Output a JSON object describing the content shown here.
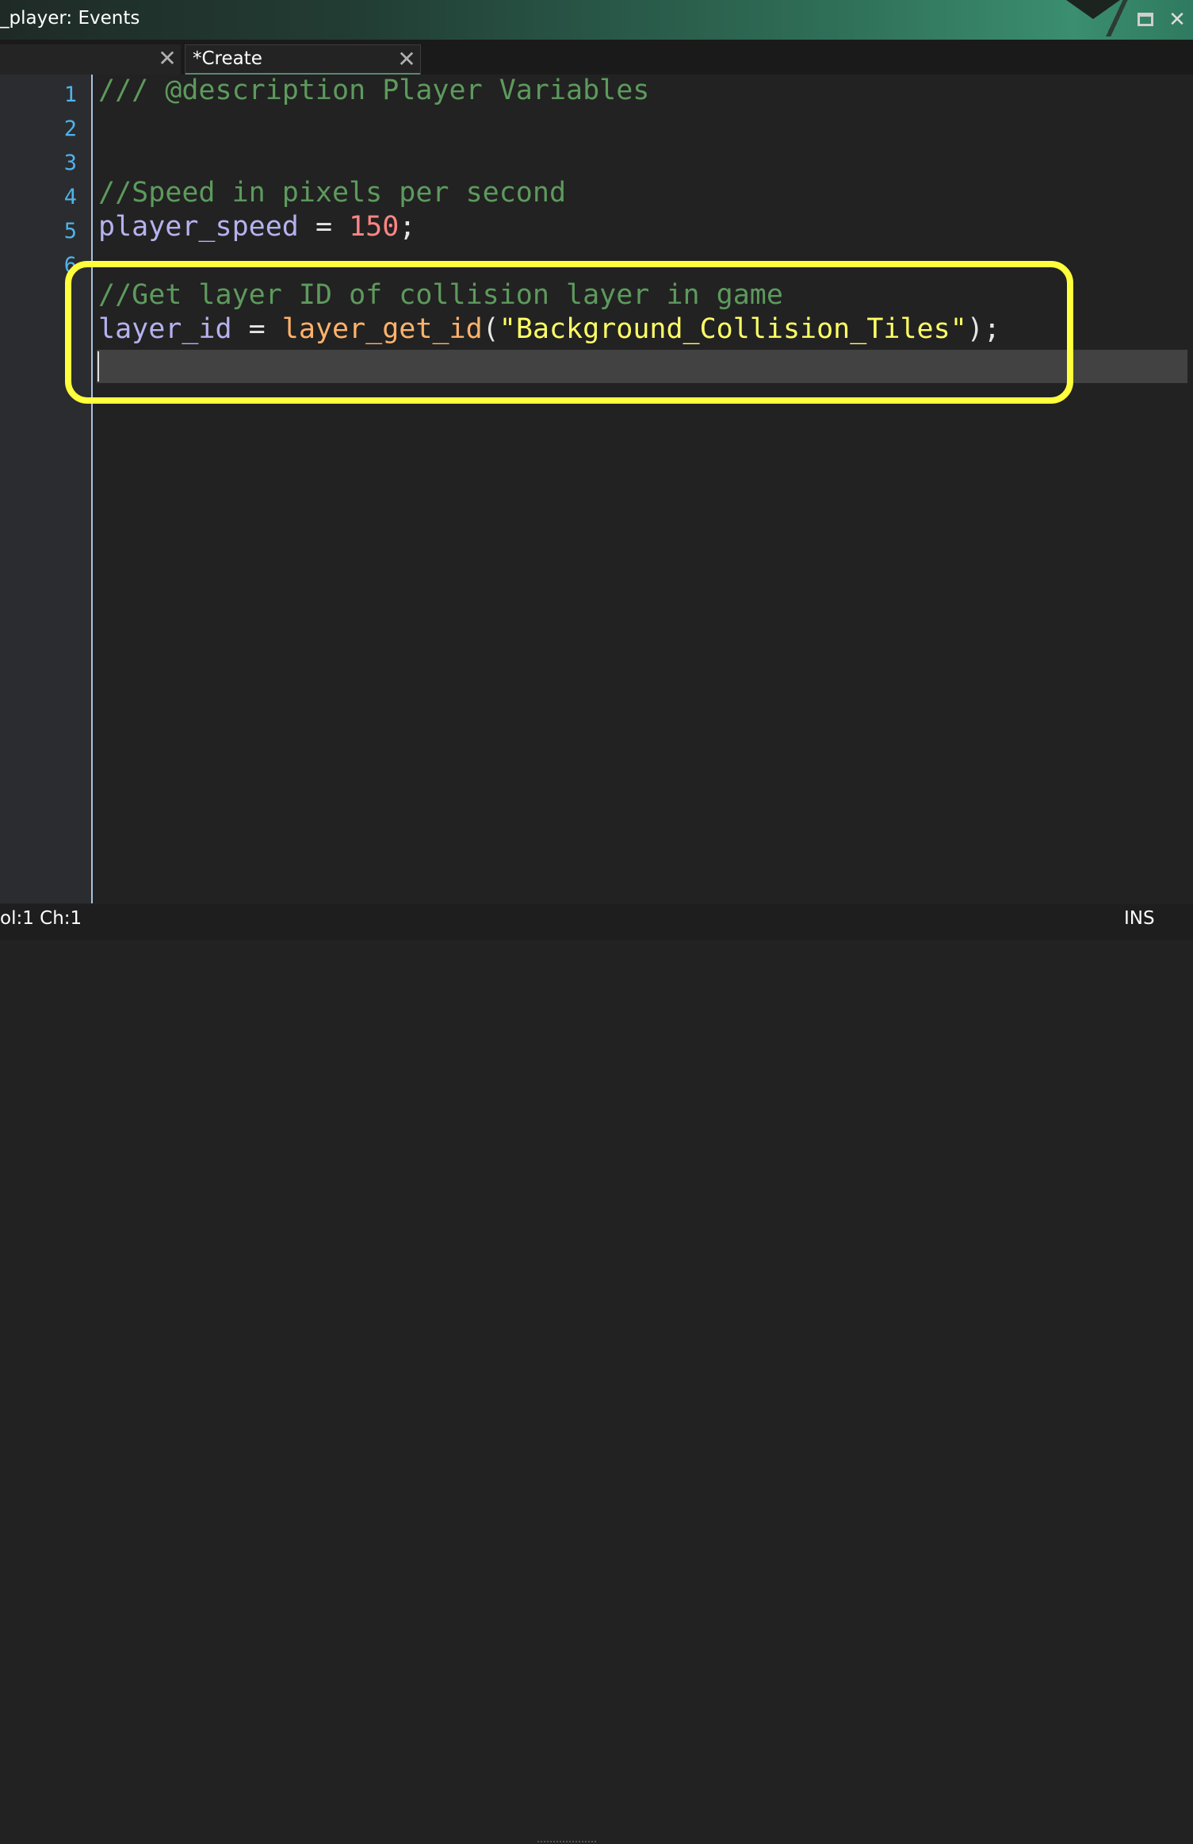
{
  "window": {
    "title": "_player: Events",
    "maximize_icon": "maximize-icon",
    "close_icon": "close-icon"
  },
  "tabs": [
    {
      "label": "",
      "active": false
    },
    {
      "label": "*Create",
      "active": true
    }
  ],
  "editor": {
    "line_numbers": [
      "1",
      "2",
      "3",
      "4",
      "5",
      "6"
    ],
    "lines": {
      "l1_comment": "/// @description Player Variables",
      "l4_comment": "//Speed in pixels per second",
      "l5_var": "player_speed",
      "l5_op": " = ",
      "l5_num": "150",
      "l5_end": ";",
      "l7_comment": "//Get layer ID of collision layer in game",
      "l8_var": "layer_id",
      "l8_op": " = ",
      "l8_func": "layer_get_id",
      "l8_paren_open": "(",
      "l8_str": "\"Background_Collision_Tiles\"",
      "l8_end": ");"
    },
    "highlight_color": "#ffff3c"
  },
  "status": {
    "position": "ol:1 Ch:1",
    "mode": "INS"
  }
}
